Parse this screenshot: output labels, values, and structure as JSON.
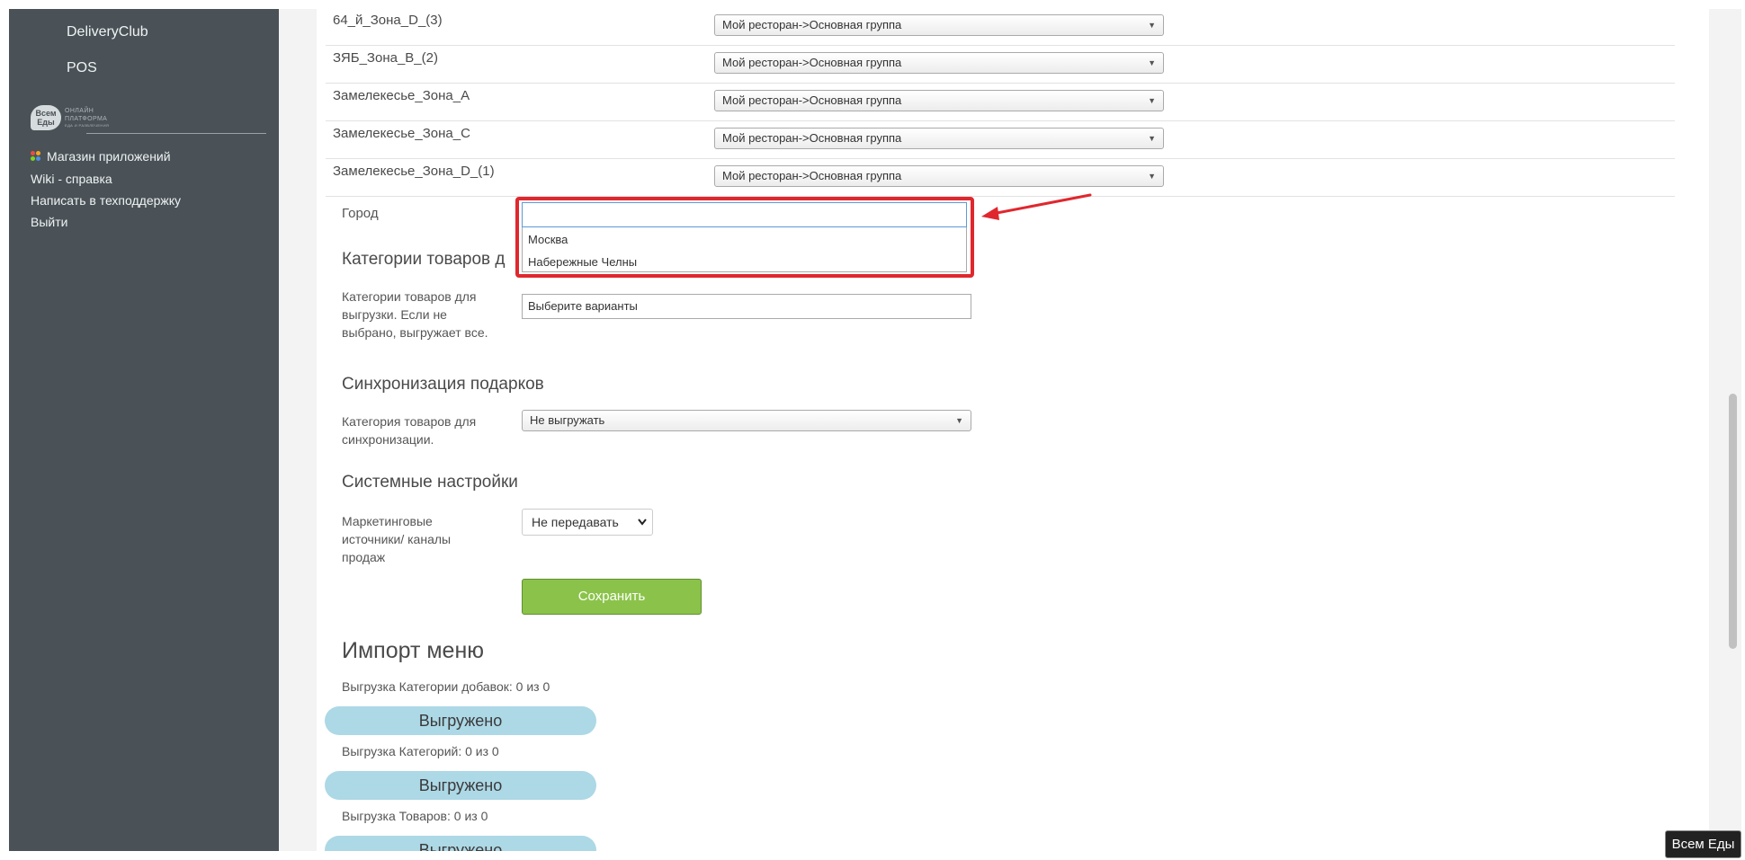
{
  "sidebar": {
    "top_items": [
      "DeliveryClub",
      "POS"
    ],
    "logo": {
      "mark": "Всем Еды",
      "line1": "ОНЛАЙН",
      "line2": "ПЛАТФОРМА",
      "line3": "ЕДА И РАЗВЛЕЧЕНИЯ"
    },
    "links": [
      "Магазин приложений",
      "Wiki - справка",
      "Написать в техподдержку",
      "Выйти"
    ]
  },
  "zones": [
    {
      "name": "64_й_Зона_D_(3)",
      "value": "Мой ресторан->Основная группа"
    },
    {
      "name": "ЗЯБ_Зона_B_(2)",
      "value": "Мой ресторан->Основная группа"
    },
    {
      "name": "Замелекесье_Зона_A",
      "value": "Мой ресторан->Основная группа"
    },
    {
      "name": "Замелекесье_Зона_C",
      "value": "Мой ресторан->Основная группа"
    },
    {
      "name": "Замелекесье_Зона_D_(1)",
      "value": "Мой ресторан->Основная группа"
    }
  ],
  "city": {
    "label": "Город",
    "input_value": "",
    "options": [
      "Москва",
      "Набережные Челны"
    ]
  },
  "categories_section": {
    "title_visible": "Категории товаров д",
    "label_lines": [
      "Категории товаров для",
      "выгрузки. Если не",
      "выбрано, выгружает все."
    ],
    "placeholder": "Выберите варианты"
  },
  "gifts_section": {
    "title": "Синхронизация подарков",
    "label_lines": [
      "Категория товаров для",
      "синхронизации."
    ],
    "value": "Не выгружать"
  },
  "system_section": {
    "title": "Системные настройки",
    "label_lines": [
      "Маркетинговые",
      "источники/ каналы",
      "продаж"
    ],
    "value": "Не передавать"
  },
  "save_label": "Сохранить",
  "import": {
    "title": "Импорт меню",
    "items": [
      {
        "label": "Выгрузка Категории добавок: 0 из 0",
        "button": "Выгружено"
      },
      {
        "label": "Выгрузка Категорий: 0 из 0",
        "button": "Выгружено"
      },
      {
        "label": "Выгрузка Товаров: 0 из 0",
        "button": "Выгружено"
      }
    ]
  },
  "tooltip": "Всем Еды",
  "colors": {
    "highlight": "#e0272e",
    "save": "#8bc34a",
    "import_button": "#add8e6",
    "sidebar": "#4a5257"
  }
}
